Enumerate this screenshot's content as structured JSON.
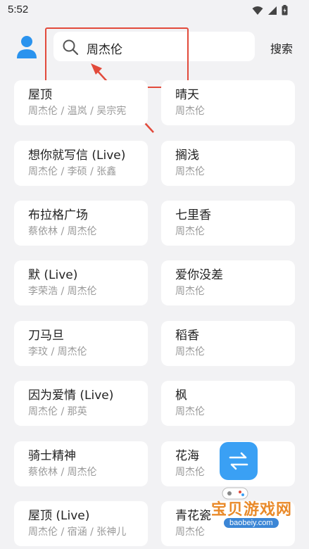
{
  "status_bar": {
    "time": "5:52"
  },
  "header": {
    "search_value": "周杰伦",
    "search_button": "搜索"
  },
  "songs": [
    {
      "title": "屋顶",
      "artist": "周杰伦 / 温岚 / 吴宗宪"
    },
    {
      "title": "晴天",
      "artist": "周杰伦"
    },
    {
      "title": "想你就写信 (Live)",
      "artist": "周杰伦 / 李硕 / 张鑫"
    },
    {
      "title": "搁浅",
      "artist": "周杰伦"
    },
    {
      "title": "布拉格广场",
      "artist": "蔡依林 / 周杰伦"
    },
    {
      "title": "七里香",
      "artist": "周杰伦"
    },
    {
      "title": "默 (Live)",
      "artist": "李荣浩 / 周杰伦"
    },
    {
      "title": "爱你没差",
      "artist": "周杰伦"
    },
    {
      "title": "刀马旦",
      "artist": "李玟 / 周杰伦"
    },
    {
      "title": "稻香",
      "artist": "周杰伦"
    },
    {
      "title": "因为爱情 (Live)",
      "artist": "周杰伦 / 那英"
    },
    {
      "title": "枫",
      "artist": "周杰伦"
    },
    {
      "title": "骑士精神",
      "artist": "蔡依林 / 周杰伦"
    },
    {
      "title": "花海",
      "artist": "周杰伦"
    },
    {
      "title": "屋顶 (Live)",
      "artist": "周杰伦 / 宿涵 / 张神儿"
    },
    {
      "title": "青花瓷",
      "artist": "周杰伦"
    }
  ],
  "watermark": {
    "text": "宝贝游戏网",
    "url": "baobeiy.com"
  },
  "colors": {
    "accent": "#3aa0f4",
    "annotation": "#e24a3b",
    "background": "#f2f2f4"
  }
}
